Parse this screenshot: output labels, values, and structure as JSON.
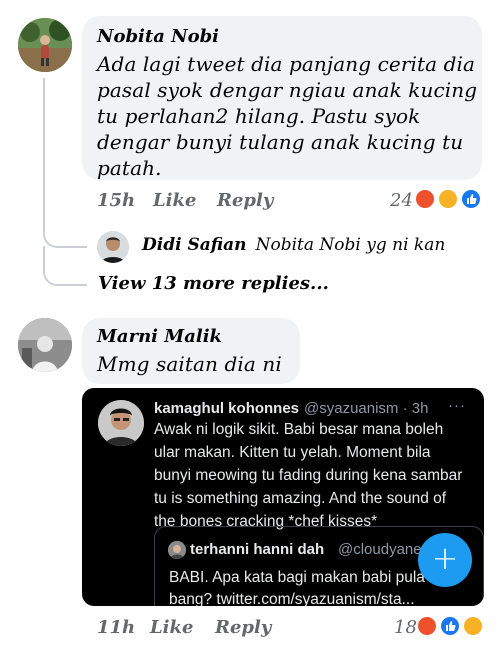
{
  "comment1": {
    "author": "Nobita Nobi",
    "lines": [
      "Ada lagi tweet dia panjang cerita dia",
      "pasal syok dengar ngiau anak kucing",
      "tu perlahan2 hilang. Pastu syok",
      "dengar bunyi tulang anak kucing tu",
      "patah."
    ],
    "time": "15h",
    "like": "Like",
    "reply": "Reply",
    "reaction_count": "24",
    "reactions": [
      "angry",
      "sad",
      "like"
    ]
  },
  "reply1": {
    "author": "Didi Safian",
    "text": "Nobita Nobi yg ni kan"
  },
  "view_more": "View 13 more replies...",
  "comment2": {
    "author": "Marni Malik",
    "text": "Mmg saitan dia ni",
    "time": "11h",
    "like": "Like",
    "reply": "Reply",
    "reaction_count": "18",
    "reactions": [
      "angry",
      "like",
      "wow"
    ]
  },
  "tweet": {
    "name": "kamaghul kohonnes",
    "handle": "@syazuanism · 3h",
    "more": "···",
    "lines": [
      "Awak ni logik sikit. Babi besar mana boleh",
      "ular makan. Kitten tu yelah. Moment bila",
      "bunyi meowing tu fading during kena sambar",
      "tu is something amazing. And the sound of",
      "the bones cracking *chef kisses*"
    ],
    "quote": {
      "name": "terhanni hanni dah",
      "handle": "@cloudyane",
      "lines": [
        "BABI. Apa kata bagi makan babi pula",
        "bang? twitter.com/syazuanism/sta..."
      ]
    },
    "fab_label": "+"
  },
  "colors": {
    "bubble": "#f0f2f5",
    "meta_gray": "#65676b",
    "twitter_blue": "#1d9bf0",
    "angry": "#f0512d",
    "sad": "#f7b125",
    "like": "#1877f2"
  }
}
